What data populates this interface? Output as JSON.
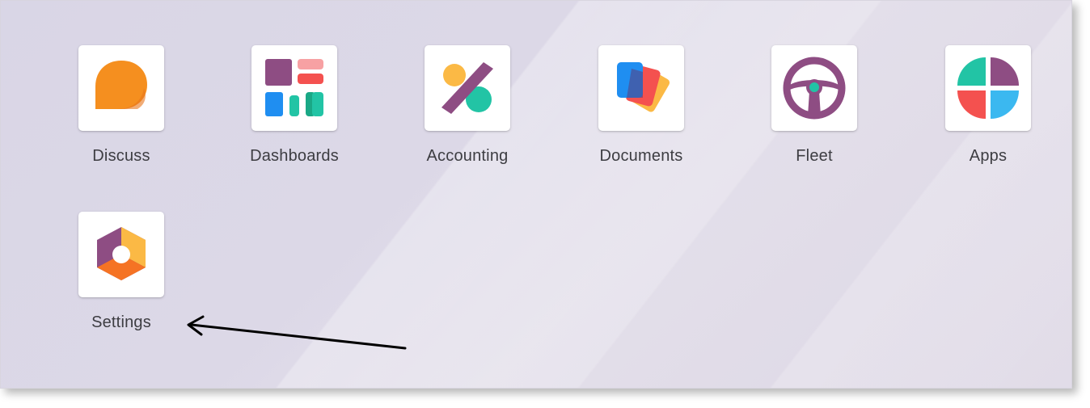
{
  "apps": [
    {
      "label": "Discuss",
      "icon": "discuss-icon"
    },
    {
      "label": "Dashboards",
      "icon": "dashboards-icon"
    },
    {
      "label": "Accounting",
      "icon": "accounting-icon"
    },
    {
      "label": "Documents",
      "icon": "documents-icon"
    },
    {
      "label": "Fleet",
      "icon": "fleet-icon"
    },
    {
      "label": "Apps",
      "icon": "apps-icon"
    },
    {
      "label": "Settings",
      "icon": "settings-icon"
    }
  ],
  "colors": {
    "orange": "#f58f1f",
    "purple": "#8e4d83",
    "teal": "#22c4a5",
    "red": "#f4514f",
    "blue": "#1f8ef1",
    "yellow": "#fbb945",
    "label": "#3d3d42"
  }
}
